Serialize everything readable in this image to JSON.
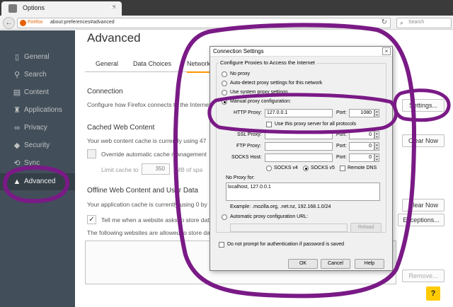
{
  "browser": {
    "tab_title": "Options",
    "new_tab": "+",
    "close_tab": "×",
    "back": "←",
    "url_brand": "Firefox",
    "url": "about:preferences#advanced",
    "search_placeholder": "Search"
  },
  "sidebar": {
    "items": [
      {
        "label": "General",
        "icon": "general-icon"
      },
      {
        "label": "Search",
        "icon": "search-icon"
      },
      {
        "label": "Content",
        "icon": "content-icon"
      },
      {
        "label": "Applications",
        "icon": "applications-icon"
      },
      {
        "label": "Privacy",
        "icon": "privacy-mask-icon"
      },
      {
        "label": "Security",
        "icon": "security-icon"
      },
      {
        "label": "Sync",
        "icon": "sync-icon"
      },
      {
        "label": "Advanced",
        "icon": "advanced-hat-icon"
      }
    ],
    "active": "Advanced"
  },
  "main": {
    "title": "Advanced",
    "tabs": [
      "General",
      "Data Choices",
      "Network"
    ],
    "connection_heading": "Connection",
    "connection_text": "Configure how Firefox connects to the Internet",
    "settings_button": "Settings...",
    "cached_heading": "Cached Web Content",
    "cached_text": "Your web content cache is currently using 47",
    "clear_now": "Clear Now",
    "override_label": "Override automatic cache management",
    "limit_label": "Limit cache to",
    "limit_value": "350",
    "limit_unit": "MB of spa",
    "offline_heading": "Offline Web Content and User Data",
    "offline_text": "Your application cache is currently using 0 by",
    "clear_now_2": "Clear Now",
    "tell_me_label": "Tell me when a website asks to store data",
    "exceptions_button": "Exceptions...",
    "allowed_text": "The following websites are allowed to store da",
    "remove_button": "Remove...",
    "help": "?"
  },
  "dialog": {
    "title": "Connection Settings",
    "close": "×",
    "group_label": "Configure Proxies to Access the Internet",
    "no_proxy": "No proxy",
    "auto_detect": "Auto-detect proxy settings for this network",
    "use_system": "Use system proxy settings",
    "manual": "Manual proxy configuration:",
    "http_proxy_label": "HTTP Proxy:",
    "http_proxy_value": "127.0.0.1",
    "port_label": "Port:",
    "http_port_value": "1080",
    "use_same": "Use this proxy server for all protocols",
    "ssl_label": "SSL Proxy:",
    "ftp_label": "FTP Proxy:",
    "socks_label": "SOCKS Host:",
    "zero": "0",
    "socks4": "SOCKS v4",
    "socks5": "SOCKS v5",
    "remote_dns": "Remote DNS",
    "no_proxy_for_label": "No Proxy for:",
    "no_proxy_for_value": "localhost, 127.0.0.1",
    "example": "Example: .mozilla.org, .net.nz, 192.168.1.0/24",
    "auto_url": "Automatic proxy configuration URL:",
    "reload": "Reload",
    "no_prompt": "Do not prompt for authentication if password is saved",
    "ok": "OK",
    "cancel": "Cancel",
    "help": "Help"
  },
  "colors": {
    "sidebar_bg": "#424f5a",
    "annotation": "#7a1a86",
    "help_button": "#ffcb00"
  }
}
